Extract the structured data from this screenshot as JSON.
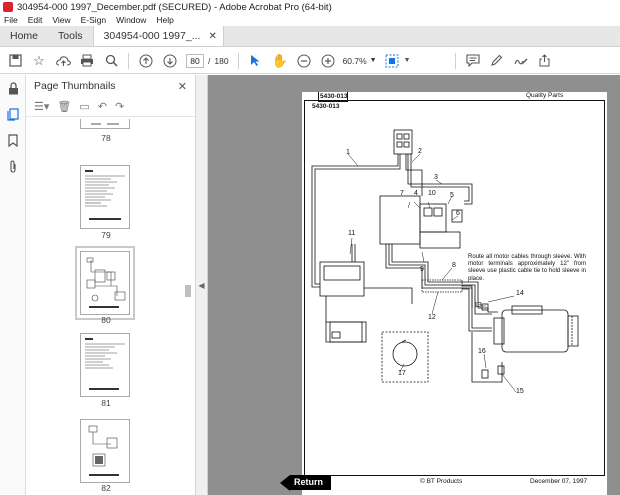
{
  "window": {
    "title": "304954-000 1997_December.pdf (SECURED) - Adobe Acrobat Pro (64-bit)"
  },
  "menu": [
    "File",
    "Edit",
    "View",
    "E-Sign",
    "Window",
    "Help"
  ],
  "tabs": {
    "home": "Home",
    "tools": "Tools",
    "document": "304954-000 1997_..."
  },
  "toolbar": {
    "page_current": "80",
    "page_separator": "/",
    "page_total": "180",
    "zoom": "60.7%"
  },
  "panel": {
    "title": "Page Thumbnails"
  },
  "thumbnails": [
    {
      "label": "78"
    },
    {
      "label": "79"
    },
    {
      "label": "80",
      "selected": true
    },
    {
      "label": "81"
    },
    {
      "label": "82"
    }
  ],
  "page": {
    "part_number_box": "5430-013",
    "part_number": "5430-013",
    "header_right": "Quality Parts",
    "callouts": [
      "1",
      "2",
      "3",
      "4",
      "5",
      "6",
      "7",
      "8",
      "9",
      "10",
      "11",
      "12",
      "13",
      "14",
      "15",
      "16",
      "17"
    ],
    "note": "Route all motor cables through sleeve. With motor terminals approximately 12\" from sleeve use plastic cable tie to hold sleeve in place.",
    "footer_center": "© BT Products",
    "footer_right": "December 07, 1997",
    "return_label": "Return"
  },
  "colors": {
    "accent": "#1473e6",
    "brand": "#d9232e",
    "viewer_bg": "#8f8f8f"
  }
}
